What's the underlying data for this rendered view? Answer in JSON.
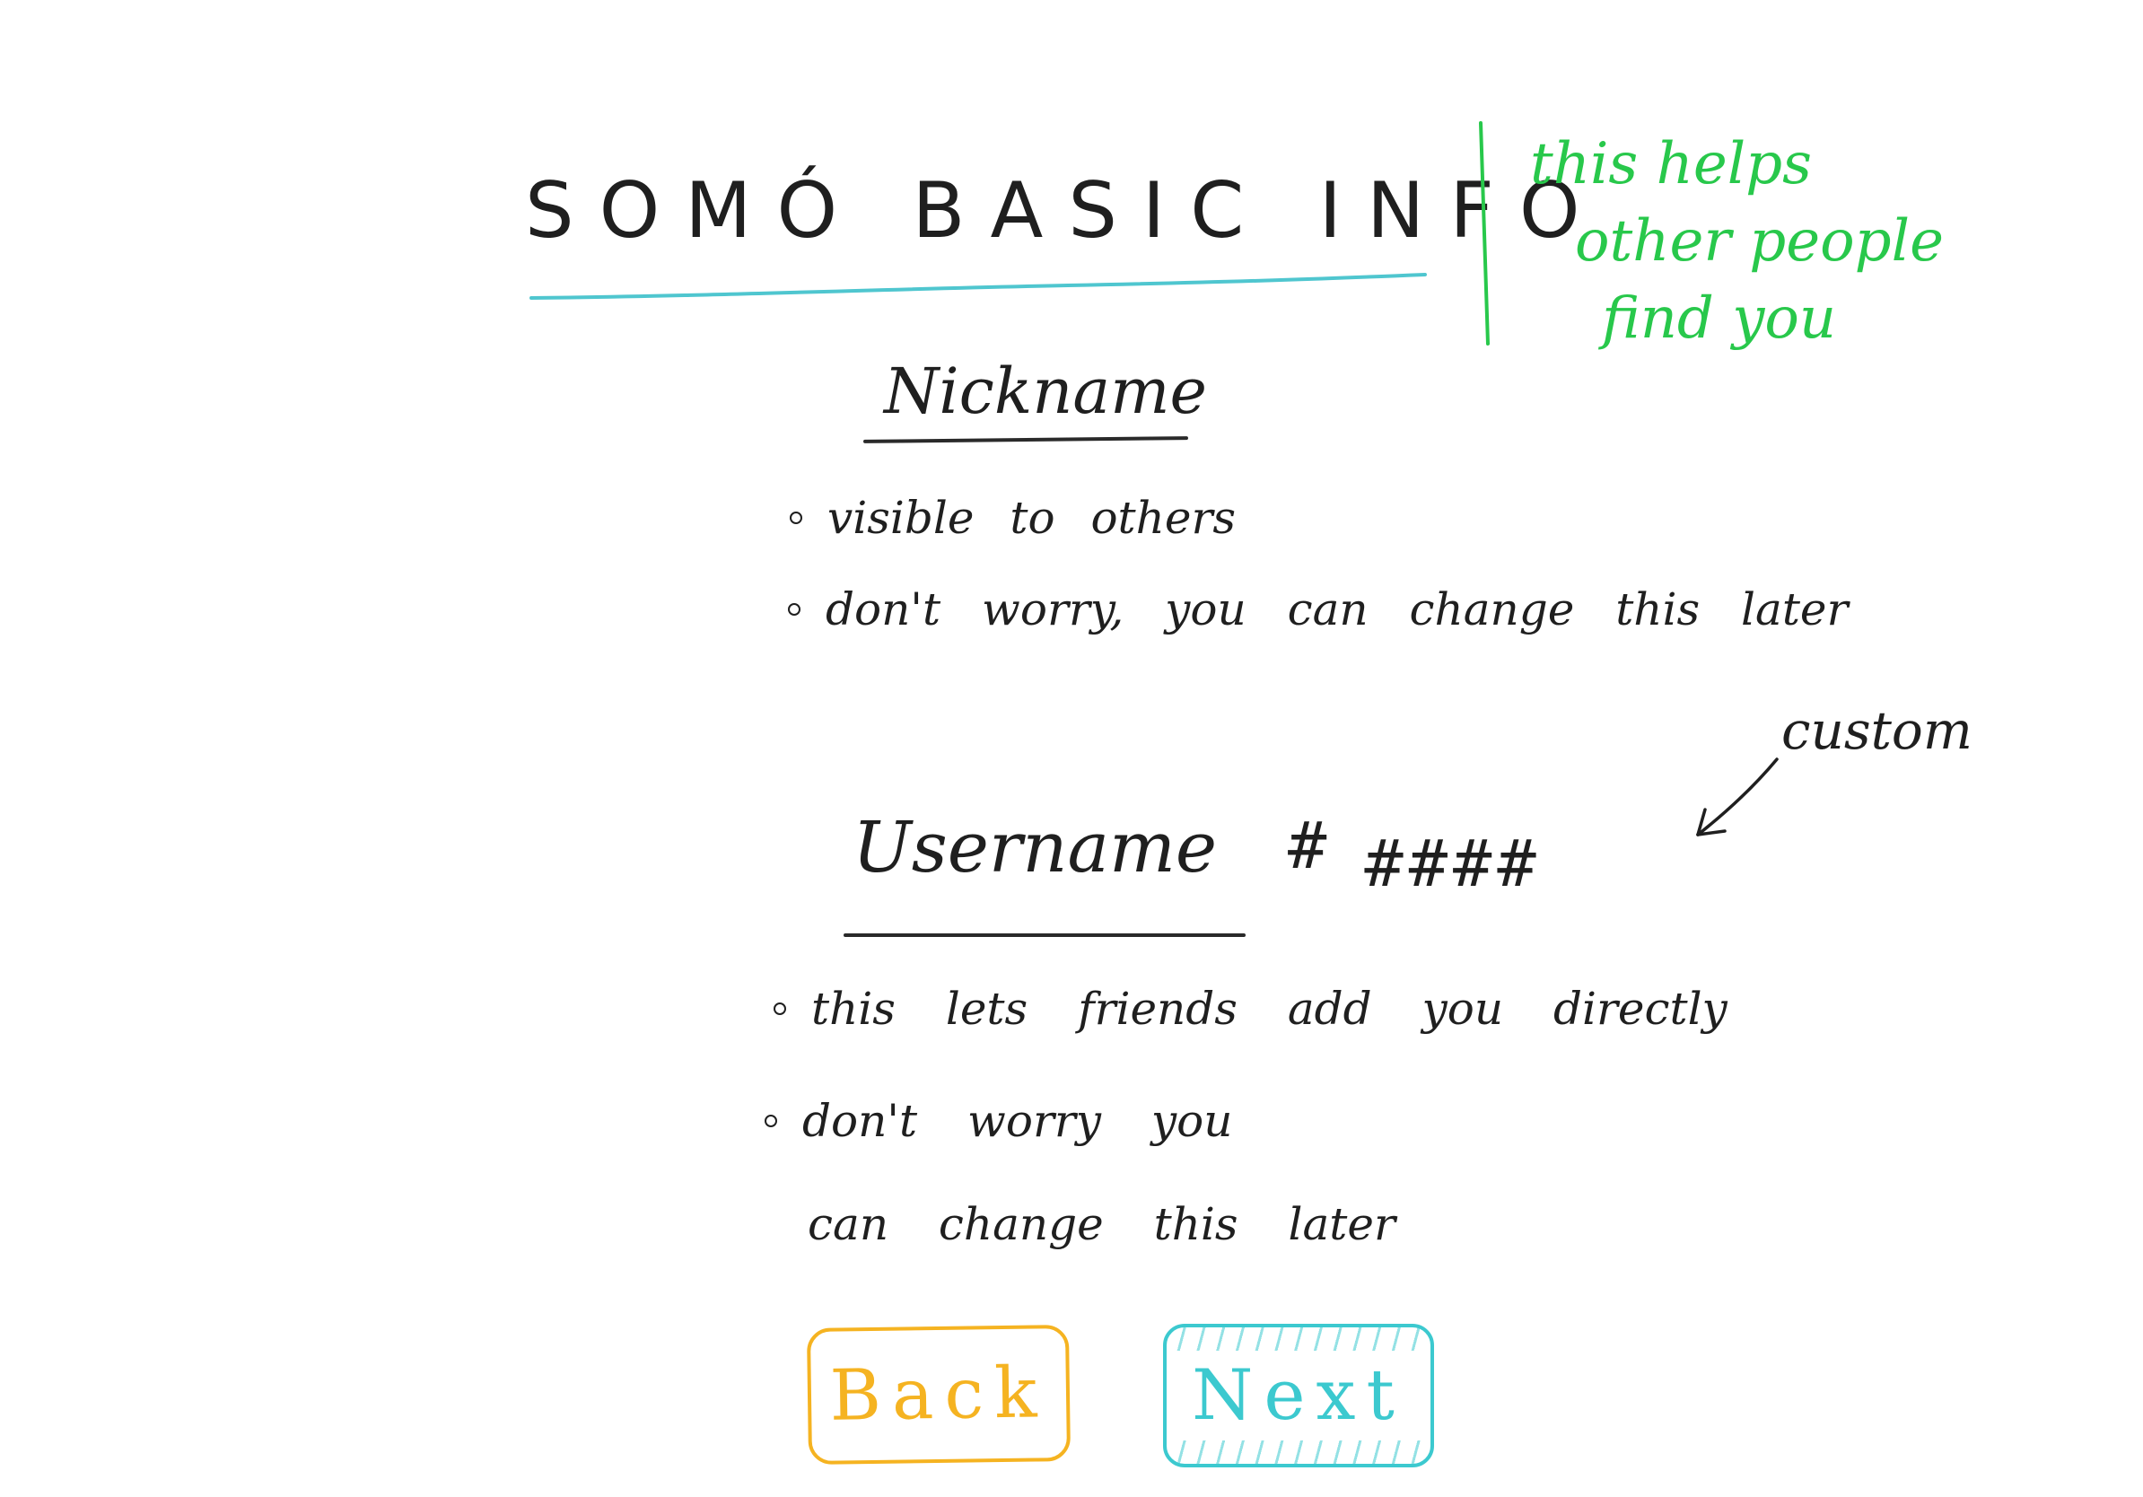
{
  "title": "SOMÓ BASIC INFO",
  "side_note": {
    "lines": [
      "this helps",
      "other people",
      "find you"
    ],
    "color": "#28c84b"
  },
  "nickname": {
    "heading": "Nickname",
    "bullets": [
      "visible to others",
      "don't worry, you can change this later"
    ]
  },
  "username": {
    "heading": "Username",
    "hash_prefix": "#",
    "hash_format": "####",
    "custom_annotation": "custom",
    "bullets": [
      "this lets friends add you directly",
      "don't worry you"
    ],
    "bullet_continuation": "can change this later"
  },
  "buttons": {
    "back_label": "Back",
    "next_label": "Next",
    "back_color": "#f5b321",
    "next_color": "#3cc9cf"
  },
  "accent_colors": {
    "title_underline": "#4fc6cf",
    "ink": "#1f1f1f"
  }
}
